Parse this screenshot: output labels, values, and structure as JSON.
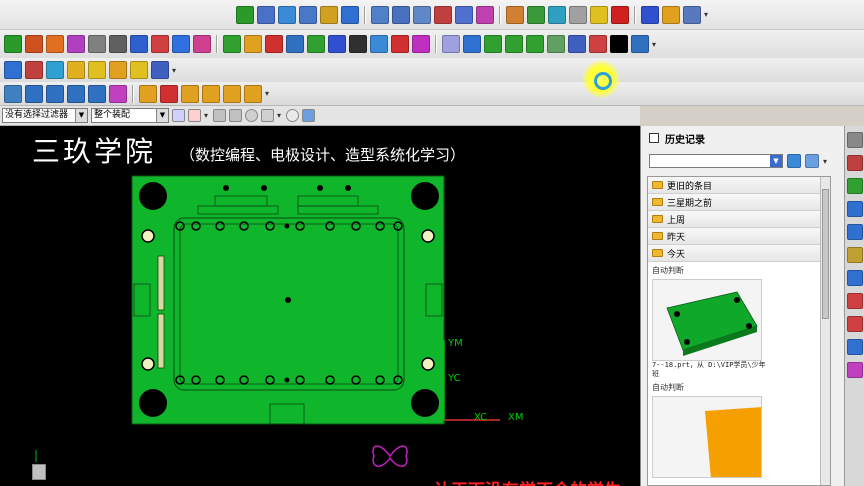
{
  "toolbar": {
    "row1_icons": [
      "green-check-icon",
      "drafting-icon",
      "drafting-2-icon",
      "note-icon",
      "flag-icon",
      "balloon-icon",
      "dimension-icon",
      "layout-icon",
      "assembly-icon",
      "hole-icon",
      "pmi-icon",
      "p-icon",
      "eraser-icon",
      "model-icon",
      "face-icon",
      "person-icon",
      "star-icon",
      "flag-red-icon",
      "flag-blue-icon",
      "gear-icon",
      "window-icon"
    ],
    "row1_colors": [
      "#2a9a2a",
      "#4a70c8",
      "#3a8ad8",
      "#4a78c8",
      "#d0a020",
      "#3070d0",
      "#5080c8",
      "#4a70c0",
      "#6088c8",
      "#c04040",
      "#5070d0",
      "#c040b0",
      "#d08030",
      "#3a9a3a",
      "#30a0c0",
      "#a0a0a0",
      "#e0c020",
      "#d02020",
      "#3050d0",
      "#e0a020",
      "#5878c0"
    ],
    "row2_icons": [
      "snap-icon",
      "block-icon",
      "box-icon",
      "cylinder-icon",
      "wave-icon",
      "sheet-icon",
      "drill-icon",
      "axis-icon",
      "cube-icon",
      "gradient-icon",
      "cone-icon",
      "trim-icon",
      "xc-icon",
      "sweep-icon",
      "chain-icon",
      "hf-icon",
      "layers-icon",
      "stack-icon",
      "corner-icon",
      "blend-icon",
      "tube-icon",
      "pipe-icon",
      "rect-icon",
      "axis-2-icon",
      "zigzag-icon",
      "shape-icon",
      "shape-2-icon",
      "text-icon",
      "pencil-icon",
      "palette-icon"
    ],
    "row2_colors": [
      "#2a9a2a",
      "#d05020",
      "#e07020",
      "#b040c0",
      "#808080",
      "#606060",
      "#3060d0",
      "#d04040",
      "#3070e0",
      "#d04090",
      "#30a030",
      "#e0a020",
      "#d03030",
      "#3070c0",
      "#30a030",
      "#3050d0",
      "#303030",
      "#3a8ad8",
      "#d03030",
      "#c030c0",
      "#a0a0e0",
      "#3070d0",
      "#30a030",
      "#30a030",
      "#30a030",
      "#60a060",
      "#4060c0",
      "#d04040",
      "#000000",
      "#3070c0"
    ],
    "row3_icons": [
      "node-icon",
      "dxf-icon",
      "layer-icon",
      "folder-icon",
      "note-icon",
      "calc-icon",
      "moon-icon",
      "grid-icon"
    ],
    "row3_colors": [
      "#3070d0",
      "#c04040",
      "#30a0d0",
      "#e0b020",
      "#e0c020",
      "#e0a020",
      "#e0c020",
      "#4060c0"
    ],
    "row4_icons": [
      "mesh-icon",
      "cube-view-icon",
      "layers-view-icon",
      "spline-icon",
      "shrink-icon",
      "surface-icon",
      "arrow-up-icon",
      "arrow-down-icon",
      "level-icon",
      "level-2-icon",
      "level-3-icon",
      "level-4-icon"
    ],
    "row4_colors": [
      "#4080c0",
      "#3070c0",
      "#3070c0",
      "#3070c0",
      "#3070c0",
      "#c040c0",
      "#e0a020",
      "#d03030",
      "#e0a020",
      "#e0a020",
      "#e0a020",
      "#e0a020"
    ]
  },
  "selection_bar": {
    "filter_value": "没有选择过滤器",
    "assembly_value": "整个装配"
  },
  "viewport": {
    "title": "三玖学院",
    "subtitle": "（数控编程、电极设计、造型系统化学习）",
    "axis_labels": {
      "ym": "YM",
      "yc": "YC",
      "xc": "XC",
      "xm": "XM"
    },
    "bottom_text_red": "让天下没有学不会的学生"
  },
  "history": {
    "title": "历史记录",
    "folders": [
      "更旧的条目",
      "三星期之前",
      "上周",
      "昨天",
      "今天"
    ],
    "auto_label": "自动判断",
    "thumb1_caption": "7--18.prt，从 D:\\VIP学员\\少年班",
    "auto_label_2": "自动判断"
  },
  "colors": {
    "pcb_green": "#0fb52a",
    "background": "#000000",
    "thumb_orange": "#f5a000"
  }
}
